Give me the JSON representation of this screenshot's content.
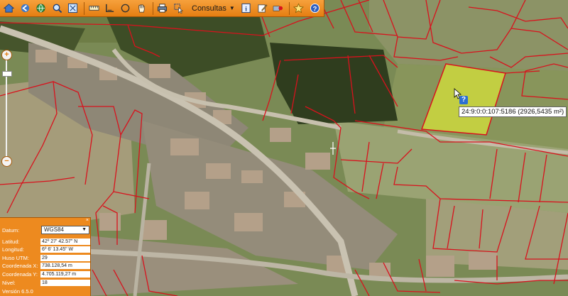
{
  "toolbar": {
    "consultas_label": "Consultas",
    "icons": [
      "home-icon",
      "back-icon",
      "globe-icon",
      "zoom-icon",
      "zoom-out-icon",
      "ruler-icon",
      "area-measure-icon",
      "circle-icon",
      "hand-pan-icon",
      "print-icon",
      "select-icon",
      "info-icon",
      "edit-icon",
      "layers-icon",
      "star-icon",
      "help-icon"
    ]
  },
  "parcel": {
    "label": "24:9:0:0:107:5186 (2926,5435 m²)",
    "info_badge": "?"
  },
  "coords": {
    "datum_label": "Datum:",
    "datum_value": "WGS84",
    "latitud_label": "Latitud:",
    "latitud_value": "42º 27' 42.57\" N",
    "longitud_label": "Longitud:",
    "longitud_value": "6º 6' 13.45\" W",
    "huso_label": "Huso UTM:",
    "huso_value": "29",
    "coord_x_label": "Coordenada X:",
    "coord_x_value": "738.128,54 m",
    "coord_y_label": "Coordenada Y:",
    "coord_y_value": "4.705.119,27 m",
    "nivel_label": "Nivel:",
    "nivel_value": "18",
    "version": "Versión 6.5.0"
  },
  "colors": {
    "toolbar": "#ee8a1e",
    "parcel_line": "#d8121d",
    "highlight": "#d6e23a"
  },
  "zoom": {
    "plus": "+",
    "minus": "−"
  }
}
